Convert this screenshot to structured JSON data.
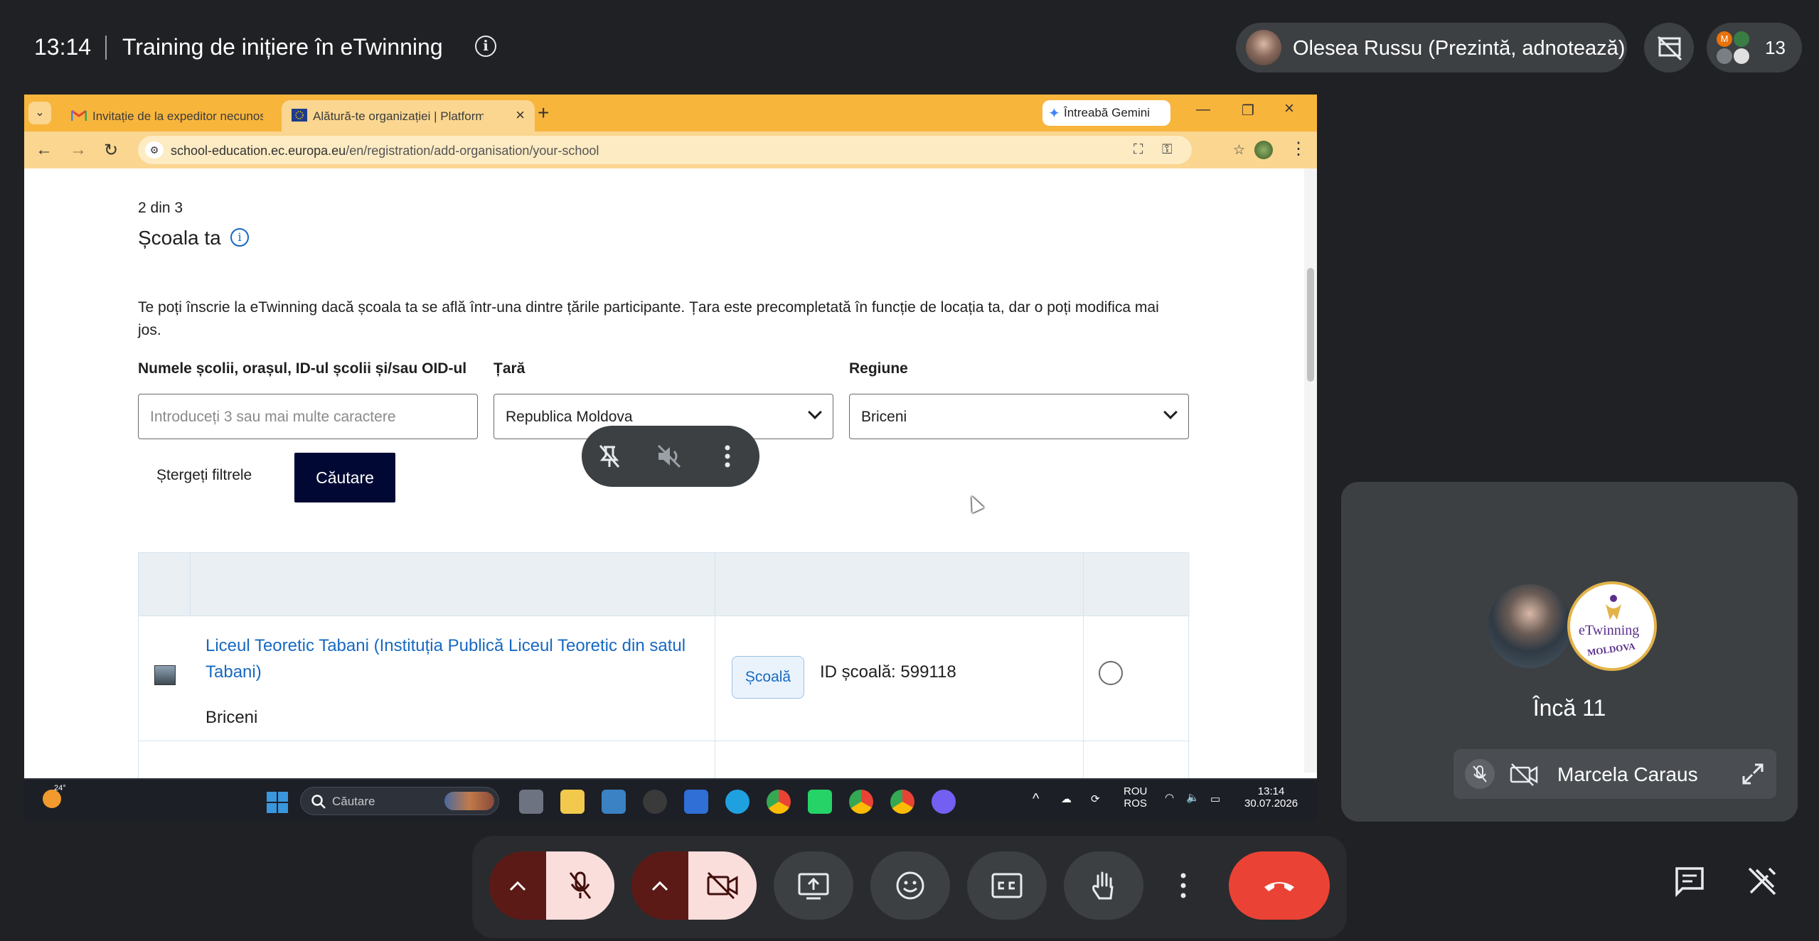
{
  "meet": {
    "time": "13:14",
    "title": "Training de inițiere în eTwinning",
    "presenter": "Olesea Russu (Prezintă, adnotează)",
    "participant_count": "13",
    "participant_initial": "M"
  },
  "browser": {
    "tabs": [
      {
        "label": "Invitație de la expeditor necunoscut",
        "active": false
      },
      {
        "label": "Alătură-te organizației | Platforma",
        "active": true
      }
    ],
    "gemini_label": "Întreabă Gemini",
    "url_host": "school-education.ec.europa.eu",
    "url_path": "/en/registration/add-organisation/your-school"
  },
  "page": {
    "step": "2 din 3",
    "title": "Școala ta",
    "intro": "Te poți înscrie la eTwinning dacă școala ta se află într-una dintre țările participante. Țara este precompletată în funcție de locația ta, dar o poți modifica mai jos.",
    "fields": {
      "school_label": "Numele școlii, orașul, ID-ul școlii și/sau OID-ul",
      "school_placeholder": "Introduceți 3 sau mai multe caractere",
      "country_label": "Țară",
      "country_value": "Republica Moldova",
      "region_label": "Regiune",
      "region_value": "Briceni"
    },
    "clear_filters": "Ștergeți filtrele",
    "search": "Căutare",
    "results": [
      {
        "name": "Liceul Teoretic Tabani (Instituția Publică Liceul Teoretic din satul Tabani)",
        "region": "Briceni",
        "type": "Școală",
        "id_text": "ID școală: 599118"
      }
    ]
  },
  "taskbar": {
    "temperature": "24°",
    "search_label": "Căutare",
    "lang_top": "ROU",
    "lang_bottom": "ROS",
    "time": "13:14",
    "date": "30.07.2026"
  },
  "tile": {
    "more_label": "Încă 11",
    "name": "Marcela Caraus",
    "logo_text": "eTwinning",
    "logo_sub": "MOLDOVA"
  },
  "colors": {
    "meet_bg": "#202124",
    "chrome_tabbar": "#f8b53c",
    "link_blue": "#1769c2",
    "search_button": "#000833",
    "hangup_red": "#ea4335"
  }
}
